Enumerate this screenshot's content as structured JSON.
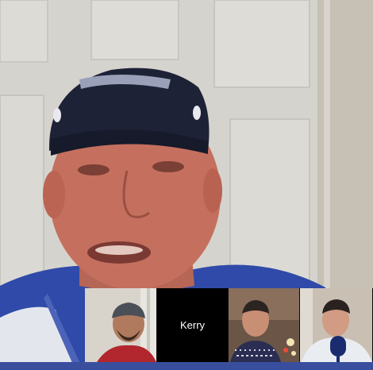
{
  "call": {
    "main_speaker": {
      "video_label": "main-speaker-video"
    },
    "participants": [
      {
        "name": "",
        "has_video": true
      },
      {
        "name": "Kerry",
        "has_video": false
      },
      {
        "name": "",
        "has_video": true
      },
      {
        "name": "",
        "has_video": true
      }
    ]
  },
  "colors": {
    "door_white": "#d9d8d3",
    "shirt_blue": "#2f4aa8",
    "skin": "#c56f5e",
    "cap_navy": "#1d2236",
    "tile_black": "#000000"
  }
}
